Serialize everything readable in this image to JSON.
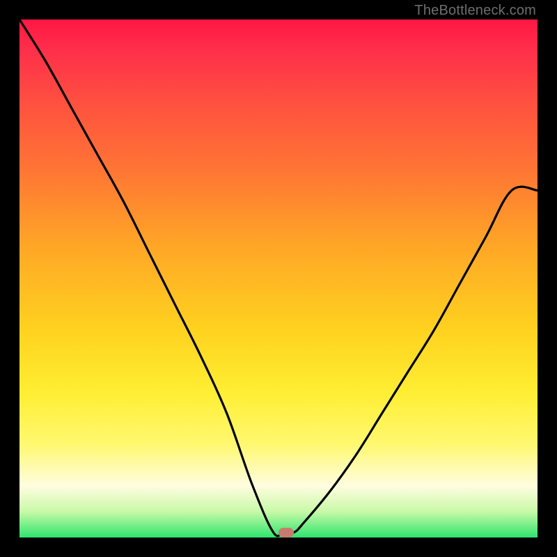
{
  "watermark": "TheBottleneck.com",
  "chart_data": {
    "type": "line",
    "title": "",
    "xlabel": "",
    "ylabel": "",
    "xlim": [
      0,
      100
    ],
    "ylim": [
      0,
      100
    ],
    "grid": false,
    "series": [
      {
        "name": "curve",
        "x": [
          0,
          5,
          10,
          15,
          20,
          25,
          30,
          35,
          40,
          45,
          49,
          51,
          53,
          55,
          60,
          65,
          70,
          75,
          80,
          85,
          90,
          95,
          100
        ],
        "y": [
          100,
          92,
          83,
          74,
          65,
          55,
          45,
          35,
          24,
          10,
          1,
          1,
          1,
          3,
          9,
          16,
          24,
          32,
          40,
          49,
          58,
          67,
          67
        ]
      }
    ],
    "marker": {
      "x": 51.5,
      "y": 1
    },
    "colors": {
      "curve": "#000000",
      "marker": "#c77b6f",
      "gradient_top": "#ff1744",
      "gradient_mid": "#ffee33",
      "gradient_bottom": "#2ee56e",
      "frame": "#000000"
    }
  }
}
